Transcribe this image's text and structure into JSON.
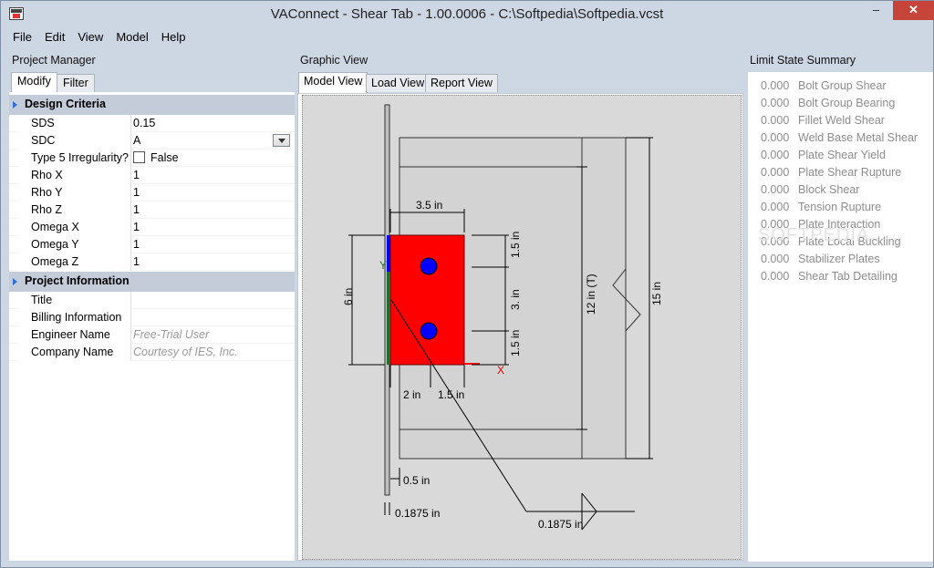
{
  "window": {
    "title": "VAConnect - Shear Tab - 1.00.0006 - C:\\Softpedia\\Softpedia.vcst",
    "min": "–",
    "max": "☐",
    "close": "✕"
  },
  "menu": [
    "File",
    "Edit",
    "View",
    "Model",
    "Help"
  ],
  "project_manager": {
    "header": "Project Manager",
    "tabs": [
      "Modify",
      "Filter"
    ],
    "design_criteria": {
      "title": "Design Criteria",
      "rows": [
        {
          "key": "SDS",
          "value": "0.15"
        },
        {
          "key": "SDC",
          "value": "A"
        },
        {
          "key": "Type 5 Irregularity?",
          "value": "False"
        },
        {
          "key": "Rho X",
          "value": "1"
        },
        {
          "key": "Rho Y",
          "value": "1"
        },
        {
          "key": "Rho Z",
          "value": "1"
        },
        {
          "key": "Omega X",
          "value": "1"
        },
        {
          "key": "Omega Y",
          "value": "1"
        },
        {
          "key": "Omega Z",
          "value": "1"
        }
      ]
    },
    "project_information": {
      "title": "Project Information",
      "rows": [
        {
          "key": "Title",
          "value": ""
        },
        {
          "key": "Billing Information",
          "value": ""
        },
        {
          "key": "Engineer Name",
          "value": "Free-Trial User"
        },
        {
          "key": "Company Name",
          "value": "Courtesy of IES, Inc."
        }
      ]
    }
  },
  "graphic_view": {
    "header": "Graphic View",
    "tabs": [
      "Model View",
      "Load View",
      "Report View"
    ],
    "dims": {
      "top": "3.5 in",
      "side_6": "6 in",
      "s1": "1.5 in",
      "s3": "3. in",
      "s2": "1.5 in",
      "h12": "12 in (T)",
      "h15": "15 in",
      "b2": "2 in",
      "b15": "1.5 in",
      "d05": "0.5 in",
      "d1875a": "0.1875 in",
      "d1875b": "0.1875 in",
      "axis_x": "X",
      "axis_y": "Y"
    }
  },
  "limit_state": {
    "header": "Limit State Summary",
    "items": [
      {
        "value": "0.000",
        "label": "Bolt Group Shear"
      },
      {
        "value": "0.000",
        "label": "Bolt Group Bearing"
      },
      {
        "value": "0.000",
        "label": "Fillet Weld Shear"
      },
      {
        "value": "0.000",
        "label": "Weld Base Metal Shear"
      },
      {
        "value": "0.000",
        "label": "Plate Shear Yield"
      },
      {
        "value": "0.000",
        "label": "Plate Shear Rupture"
      },
      {
        "value": "0.000",
        "label": "Block Shear"
      },
      {
        "value": "0.000",
        "label": "Tension Rupture"
      },
      {
        "value": "0.000",
        "label": "Plate Interaction"
      },
      {
        "value": "0.000",
        "label": "Plate Local Buckling"
      },
      {
        "value": "0.000",
        "label": "Stabilizer Plates"
      },
      {
        "value": "0.000",
        "label": "Shear Tab Detailing"
      }
    ],
    "watermark": "SOFTPEDIA"
  }
}
